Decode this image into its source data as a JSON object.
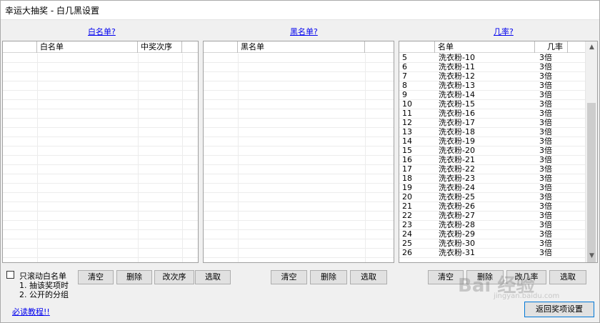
{
  "window": {
    "title": "幸运大抽奖 - 白几黑设置"
  },
  "whitelist": {
    "help_link": "白名单?",
    "columns": [
      "",
      "白名单",
      "中奖次序"
    ],
    "buttons": {
      "clear": "清空",
      "delete": "删除",
      "change_order": "改次序",
      "select": "选取"
    },
    "scroll_checkbox_label": "只滚动白名单",
    "note_1": "1. 抽该奖项时",
    "note_2": "2. 公开的分组"
  },
  "blacklist": {
    "help_link": "黑名单?",
    "columns": [
      "",
      "黑名单"
    ],
    "buttons": {
      "clear": "清空",
      "delete": "删除",
      "select": "选取"
    }
  },
  "probability": {
    "help_link": "几率?",
    "columns": [
      "",
      "名单",
      "几率"
    ],
    "rows": [
      {
        "idx": "5",
        "name": "洗衣粉-10",
        "rate": "3倍"
      },
      {
        "idx": "6",
        "name": "洗衣粉-11",
        "rate": "3倍"
      },
      {
        "idx": "7",
        "name": "洗衣粉-12",
        "rate": "3倍"
      },
      {
        "idx": "8",
        "name": "洗衣粉-13",
        "rate": "3倍"
      },
      {
        "idx": "9",
        "name": "洗衣粉-14",
        "rate": "3倍"
      },
      {
        "idx": "10",
        "name": "洗衣粉-15",
        "rate": "3倍"
      },
      {
        "idx": "11",
        "name": "洗衣粉-16",
        "rate": "3倍"
      },
      {
        "idx": "12",
        "name": "洗衣粉-17",
        "rate": "3倍"
      },
      {
        "idx": "13",
        "name": "洗衣粉-18",
        "rate": "3倍"
      },
      {
        "idx": "14",
        "name": "洗衣粉-19",
        "rate": "3倍"
      },
      {
        "idx": "15",
        "name": "洗衣粉-20",
        "rate": "3倍"
      },
      {
        "idx": "16",
        "name": "洗衣粉-21",
        "rate": "3倍"
      },
      {
        "idx": "17",
        "name": "洗衣粉-22",
        "rate": "3倍"
      },
      {
        "idx": "18",
        "name": "洗衣粉-23",
        "rate": "3倍"
      },
      {
        "idx": "19",
        "name": "洗衣粉-24",
        "rate": "3倍"
      },
      {
        "idx": "20",
        "name": "洗衣粉-25",
        "rate": "3倍"
      },
      {
        "idx": "21",
        "name": "洗衣粉-26",
        "rate": "3倍"
      },
      {
        "idx": "22",
        "name": "洗衣粉-27",
        "rate": "3倍"
      },
      {
        "idx": "23",
        "name": "洗衣粉-28",
        "rate": "3倍"
      },
      {
        "idx": "24",
        "name": "洗衣粉-29",
        "rate": "3倍"
      },
      {
        "idx": "25",
        "name": "洗衣粉-30",
        "rate": "3倍"
      },
      {
        "idx": "26",
        "name": "洗衣粉-31",
        "rate": "3倍"
      }
    ],
    "buttons": {
      "clear": "清空",
      "delete": "删除",
      "change_rate": "改几率",
      "select": "选取"
    },
    "scroll_up_icon": "▲",
    "scroll_down_icon": "▼"
  },
  "footer": {
    "tutorial_link": "必读教程!!",
    "return_button": "返回奖项设置"
  },
  "watermark": {
    "logo": "Bai 经验",
    "url": "jingyan.baidu.com"
  }
}
